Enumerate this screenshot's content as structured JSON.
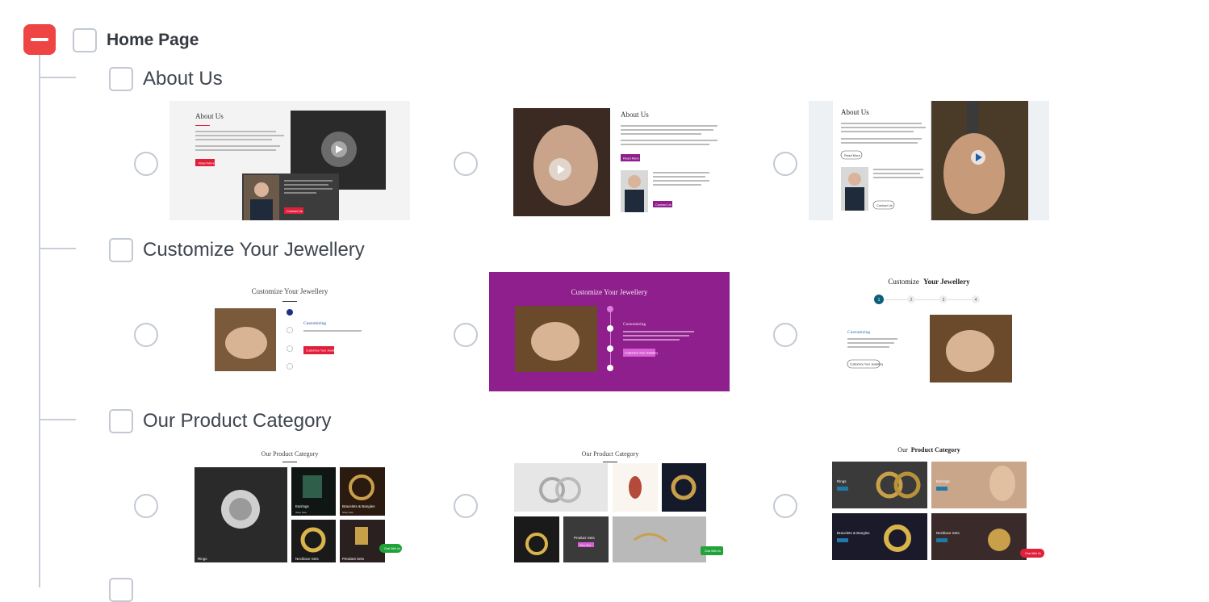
{
  "root": {
    "label": "Home Page"
  },
  "sections": [
    {
      "label": "About Us",
      "options": [
        {
          "title": "About Us",
          "read_more": "Read More",
          "contact": "Contact Us"
        },
        {
          "title": "About Us",
          "read_more": "Read More",
          "contact": "Contact Us"
        },
        {
          "title": "About Us",
          "read_more": "Read More",
          "contact": "Contact Us"
        }
      ]
    },
    {
      "label": "Customize Your Jewellery",
      "options": [
        {
          "title": "Customize Your Jewellery",
          "step_title": "Customizing",
          "button": "Customize Your Jewellery",
          "steps": [
            "1",
            "2",
            "3",
            "4"
          ]
        },
        {
          "title": "Customize Your Jewellery",
          "step_title": "Customizing",
          "button": "Customize Your Jewellery",
          "steps": [
            "1",
            "2",
            "3",
            "4"
          ]
        },
        {
          "title_prefix": "Customize",
          "title_bold": "Your Jewellery",
          "step_title": "Customizing",
          "button": "Customize Your Jewellery",
          "steps": [
            "1",
            "2",
            "3",
            "4"
          ]
        }
      ]
    },
    {
      "label": "Our Product Category",
      "options": [
        {
          "title": "Our Product Category",
          "tiles": [
            "Rings",
            "Earrings",
            "Bracelets & Bangles",
            "Necklace Sets",
            "Pendant Sets"
          ],
          "shop": "Shop Now",
          "chat": "Chat With Us"
        },
        {
          "title": "Our Product Category",
          "tiles": [
            "Product Sets"
          ],
          "shop": "Shop Now",
          "chat": "Chat With Us"
        },
        {
          "title_prefix": "Our",
          "title_bold": "Product Category",
          "tiles": [
            "Rings",
            "Earrings",
            "Bracelets & Bangles",
            "Necklace Sets"
          ],
          "shop": "Shop Now",
          "chat": "Chat With Us"
        }
      ]
    }
  ],
  "colors": {
    "danger": "#ef4444",
    "purple": "#8e1f8c",
    "red_button": "#e21f3a",
    "teal": "#0f5f7a"
  }
}
